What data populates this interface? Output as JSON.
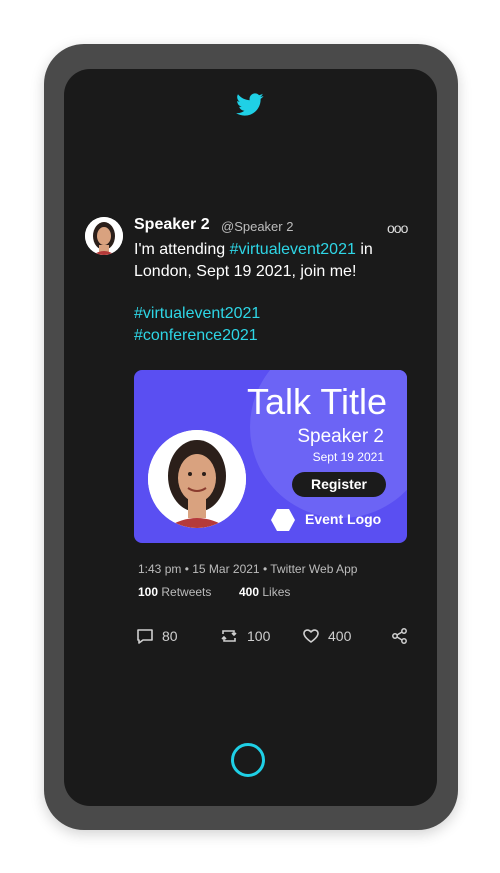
{
  "brand": {
    "accent_color": "#2ed6e6",
    "card_color": "#5a4ff2"
  },
  "tweet": {
    "name": "Speaker 2",
    "handle": "@Speaker 2",
    "more_icon": "ooo",
    "text_before": "I'm attending ",
    "text_tag": "#virtualevent2021",
    "text_after": " in London, Sept 19 2021, join me!",
    "hashtag1": "#virtualevent2021",
    "hashtag2": "#conference2021"
  },
  "card": {
    "title": "Talk Title",
    "speaker": "Speaker 2",
    "date": "Sept 19 2021",
    "register_label": "Register",
    "logo_text": "Event Logo"
  },
  "meta": {
    "timestamp": "1:43 pm • 15 Mar 2021 • Twitter Web App",
    "retweets_count": "100",
    "retweets_label": " Retweets",
    "likes_count": "400",
    "likes_label": " Likes"
  },
  "actions": {
    "replies": "80",
    "retweets": "100",
    "likes": "400"
  }
}
